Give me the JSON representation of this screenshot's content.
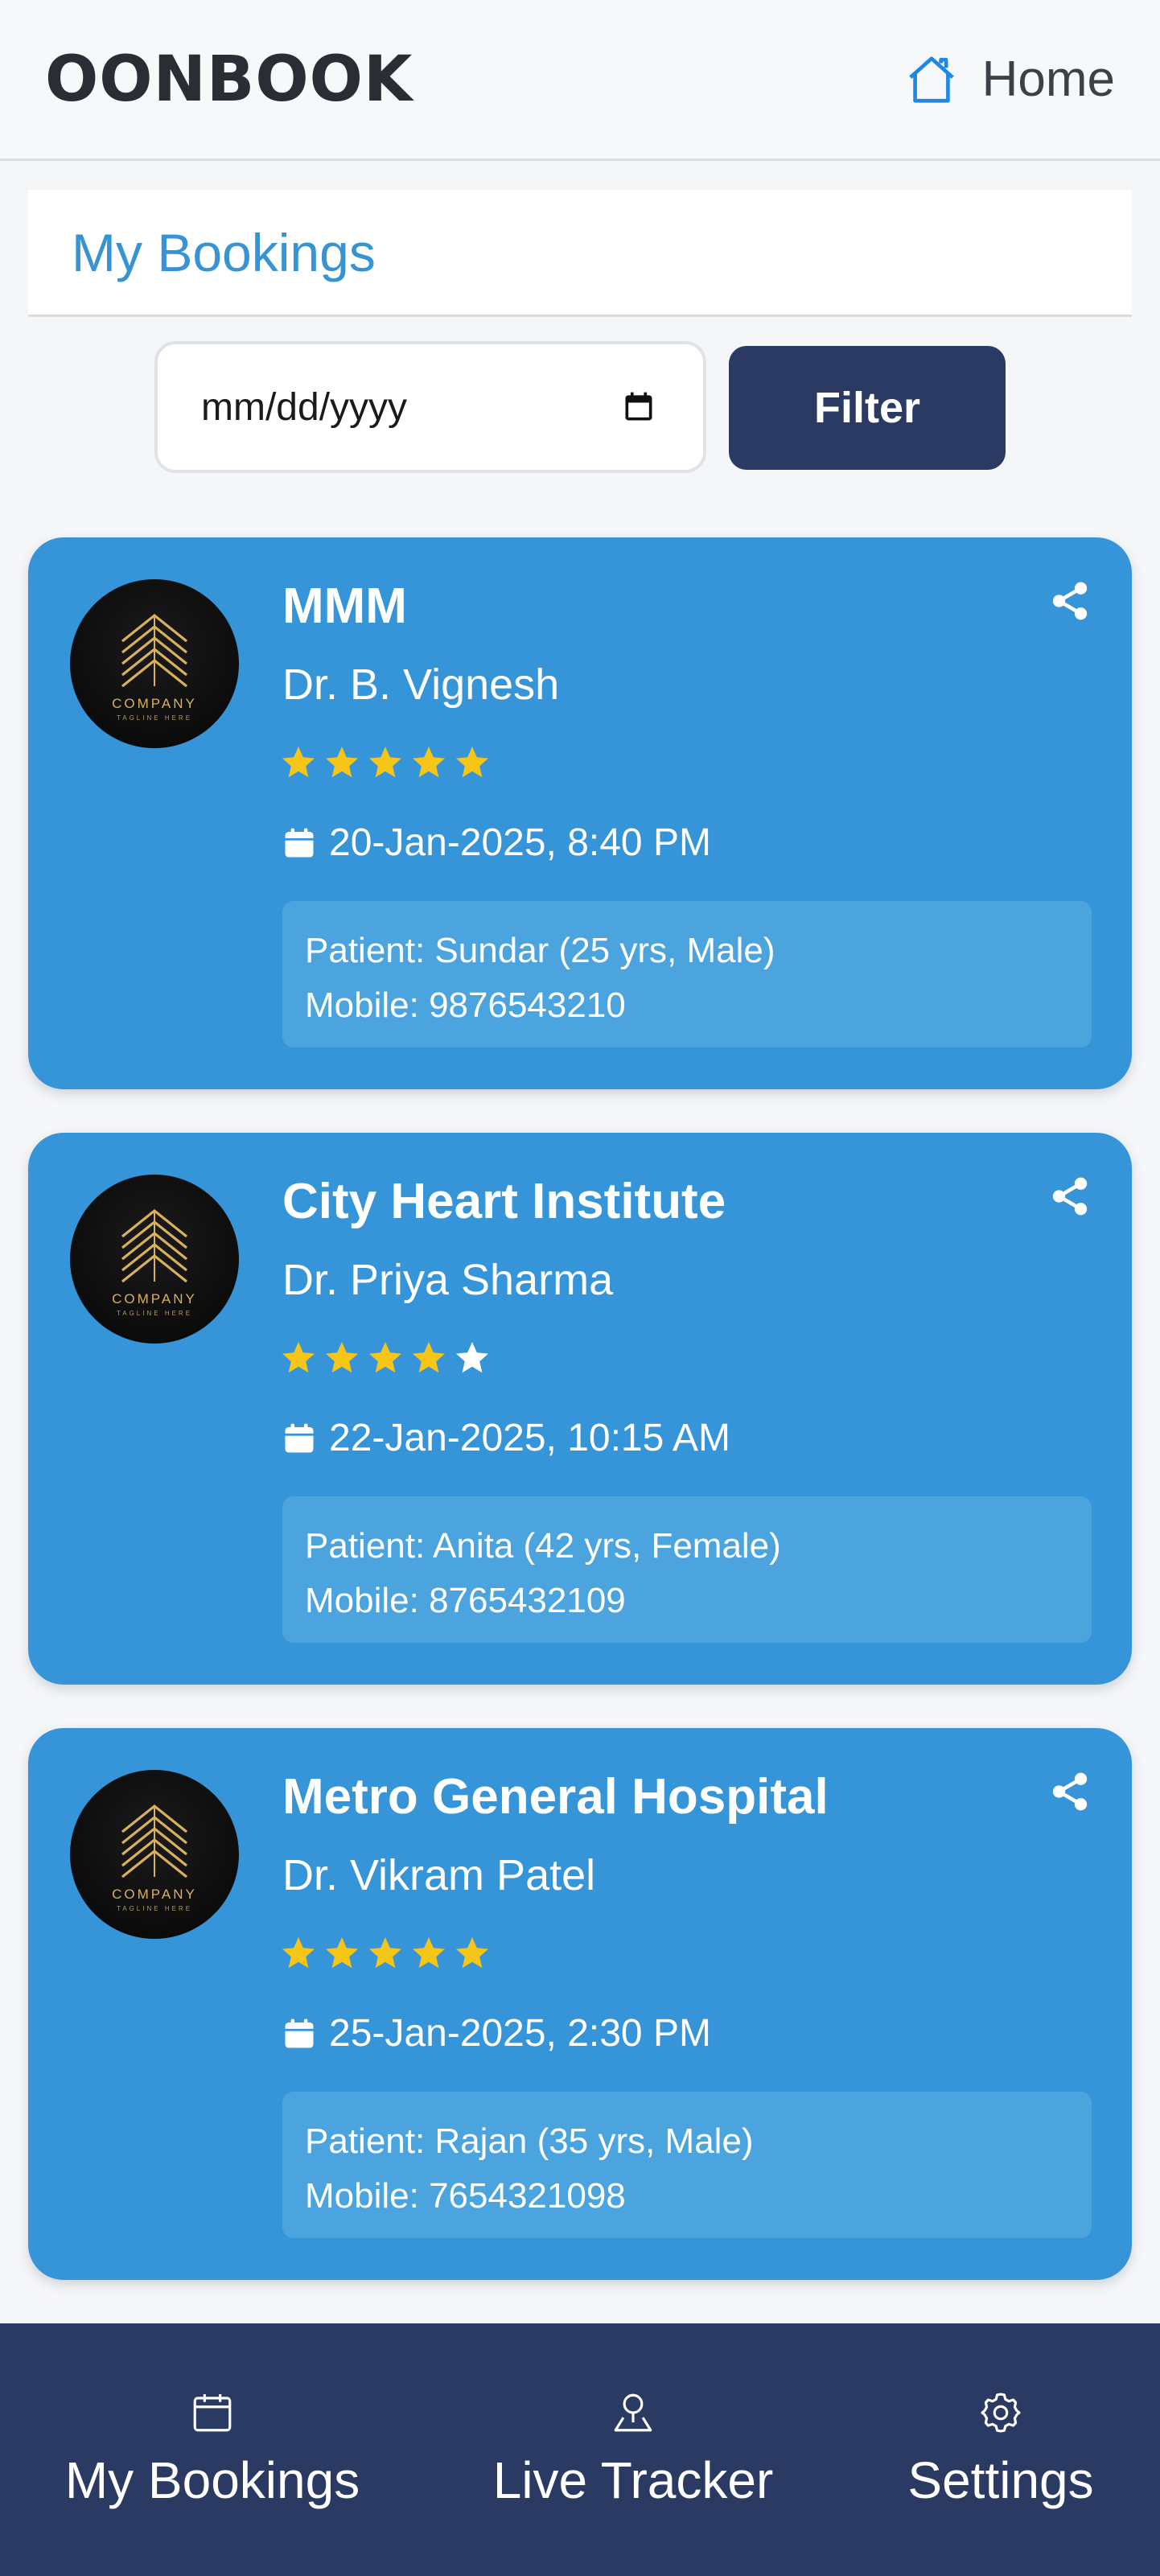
{
  "header": {
    "brand": "OONBOOK",
    "home_label": "Home"
  },
  "page": {
    "title": "My Bookings"
  },
  "filter": {
    "date_placeholder": "mm/dd/yyyy",
    "button_label": "Filter"
  },
  "logo": {
    "word": "COMPANY",
    "tagline": "TAGLINE HERE"
  },
  "bookings": [
    {
      "hospital": "MMM",
      "doctor": "Dr. B. Vignesh",
      "rating": 5,
      "datetime": "20-Jan-2025, 8:40 PM",
      "patient": "Patient: Sundar (25 yrs, Male)",
      "mobile": "Mobile: 9876543210"
    },
    {
      "hospital": "City Heart Institute",
      "doctor": "Dr. Priya Sharma",
      "rating": 4,
      "datetime": "22-Jan-2025, 10:15 AM",
      "patient": "Patient: Anita (42 yrs, Female)",
      "mobile": "Mobile: 8765432109"
    },
    {
      "hospital": "Metro General Hospital",
      "doctor": "Dr. Vikram Patel",
      "rating": 5,
      "datetime": "25-Jan-2025, 2:30 PM",
      "patient": "Patient: Rajan (35 yrs, Male)",
      "mobile": "Mobile: 7654321098"
    }
  ],
  "nav": {
    "items": [
      {
        "label": "My Bookings",
        "icon": "calendar-icon"
      },
      {
        "label": "Live Tracker",
        "icon": "location-pin-icon"
      },
      {
        "label": "Settings",
        "icon": "gear-icon"
      }
    ]
  },
  "colors": {
    "brand_text": "#2a2d33",
    "home_icon": "#1e88e5",
    "title_blue": "#3794d4",
    "card_bg": "#3595d8",
    "patient_box_bg": "#4ca4df",
    "nav_bg": "#2b3a63",
    "star_filled": "#f5c518",
    "star_empty": "#ffffff"
  }
}
